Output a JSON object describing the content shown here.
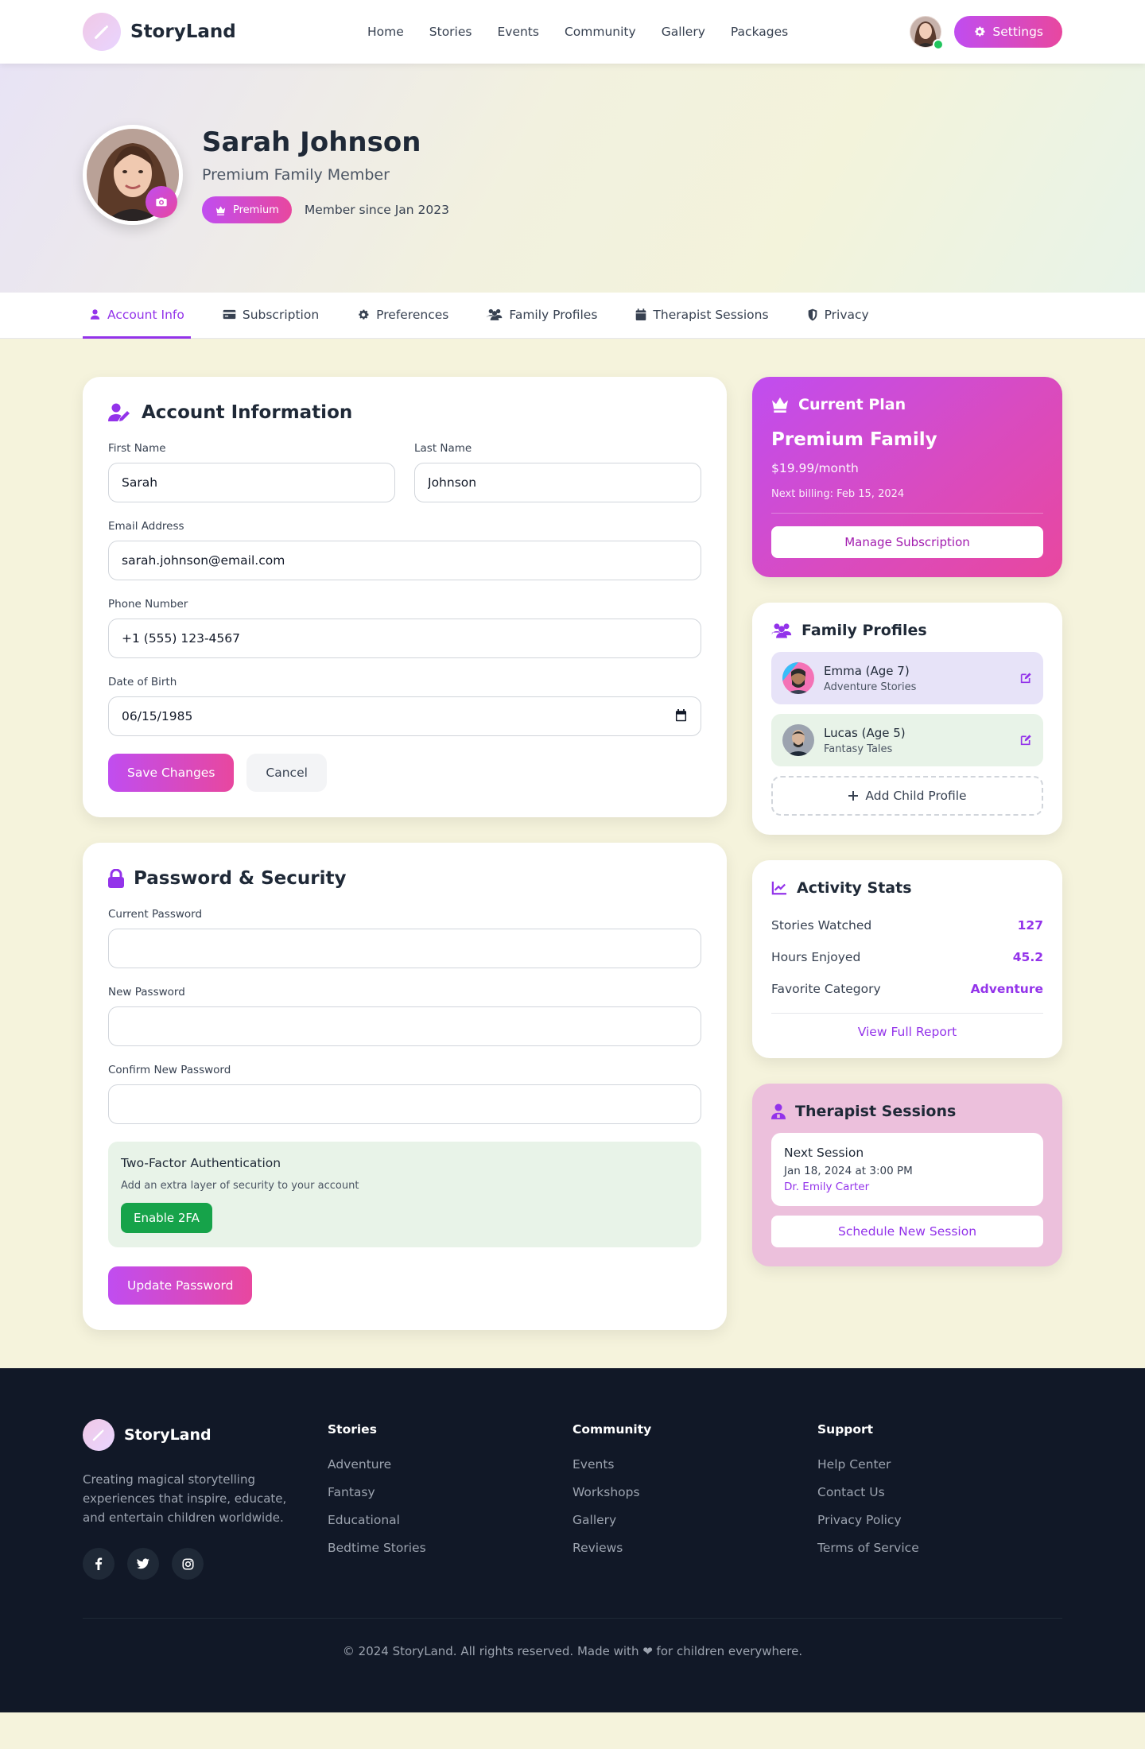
{
  "app": {
    "brand": "StoryLand",
    "nav": [
      "Home",
      "Stories",
      "Events",
      "Community",
      "Gallery",
      "Packages"
    ],
    "settings_label": "Settings"
  },
  "profile": {
    "name": "Sarah Johnson",
    "subtitle": "Premium Family Member",
    "badge": "Premium",
    "member_since": "Member since Jan 2023"
  },
  "tabs": [
    {
      "label": "Account Info",
      "icon": "user-icon",
      "active": true
    },
    {
      "label": "Subscription",
      "icon": "credit-card-icon"
    },
    {
      "label": "Preferences",
      "icon": "gear-icon"
    },
    {
      "label": "Family Profiles",
      "icon": "users-icon"
    },
    {
      "label": "Therapist Sessions",
      "icon": "calendar-icon"
    },
    {
      "label": "Privacy",
      "icon": "shield-icon"
    }
  ],
  "account": {
    "title": "Account Information",
    "first_name_label": "First Name",
    "first_name": "Sarah",
    "last_name_label": "Last Name",
    "last_name": "Johnson",
    "email_label": "Email Address",
    "email": "sarah.johnson@email.com",
    "phone_label": "Phone Number",
    "phone": "+1 (555) 123-4567",
    "dob_label": "Date of Birth",
    "dob": "06/15/1985",
    "save_label": "Save Changes",
    "cancel_label": "Cancel"
  },
  "security": {
    "title": "Password & Security",
    "current_label": "Current Password",
    "new_label": "New Password",
    "confirm_label": "Confirm New Password",
    "tfa_title": "Two-Factor Authentication",
    "tfa_desc": "Add an extra layer of security to your account",
    "tfa_button": "Enable 2FA",
    "update_label": "Update Password"
  },
  "plan": {
    "title": "Current Plan",
    "name": "Premium Family",
    "price": "$19.99/month",
    "billing": "Next billing: Feb 15, 2024",
    "button": "Manage Subscription"
  },
  "family": {
    "title": "Family Profiles",
    "children": [
      {
        "name": "Emma (Age 7)",
        "category": "Adventure Stories"
      },
      {
        "name": "Lucas (Age 5)",
        "category": "Fantasy Tales"
      }
    ],
    "add_label": "Add Child Profile"
  },
  "stats": {
    "title": "Activity Stats",
    "rows": [
      {
        "label": "Stories Watched",
        "value": "127"
      },
      {
        "label": "Hours Enjoyed",
        "value": "45.2"
      },
      {
        "label": "Favorite Category",
        "value": "Adventure"
      }
    ],
    "report_link": "View Full Report"
  },
  "therapist": {
    "title": "Therapist Sessions",
    "next_label": "Next Session",
    "date": "Jan 18, 2024 at 3:00 PM",
    "doctor": "Dr. Emily Carter",
    "schedule_label": "Schedule New Session"
  },
  "footer": {
    "brand": "StoryLand",
    "description": "Creating magical storytelling experiences that inspire, educate, and entertain children worldwide.",
    "columns": [
      {
        "heading": "Stories",
        "links": [
          "Adventure",
          "Fantasy",
          "Educational",
          "Bedtime Stories"
        ]
      },
      {
        "heading": "Community",
        "links": [
          "Events",
          "Workshops",
          "Gallery",
          "Reviews"
        ]
      },
      {
        "heading": "Support",
        "links": [
          "Help Center",
          "Contact Us",
          "Privacy Policy",
          "Terms of Service"
        ]
      }
    ],
    "copyright": "© 2024 StoryLand. All rights reserved. Made with ❤ for children everywhere."
  },
  "colors": {
    "accent": "#9333ea",
    "gradient_start": "#c04df0",
    "gradient_end": "#e8479f",
    "success": "#16a34a",
    "footer_bg": "#111827"
  }
}
